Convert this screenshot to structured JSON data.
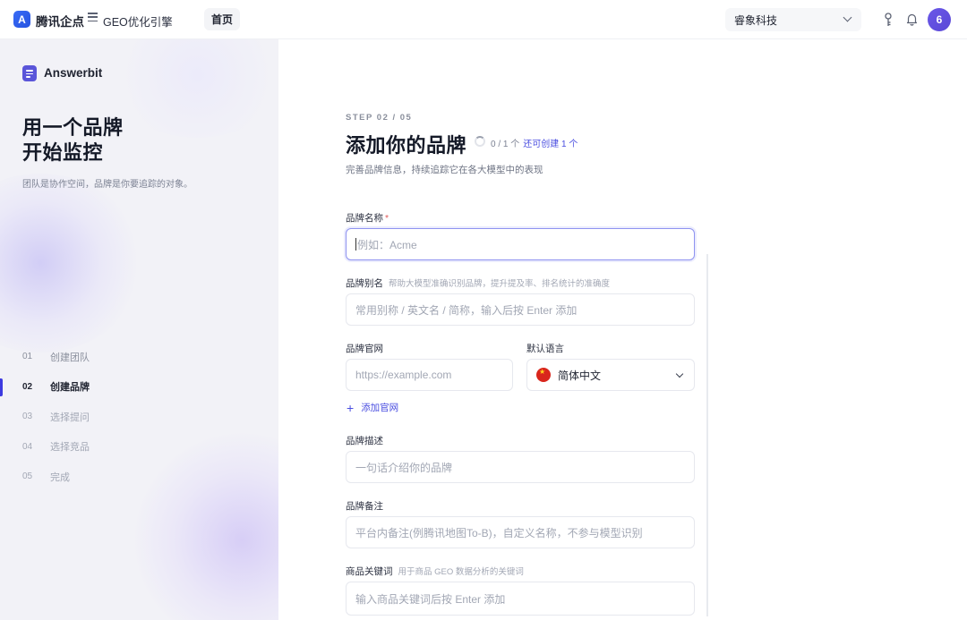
{
  "topbar": {
    "logo_letter": "A",
    "app_title": "腾讯企点",
    "product_name": "GEO优化引擎",
    "home_tab": "首页",
    "org_name": "睿象科技",
    "avatar_text": "6"
  },
  "sidebar": {
    "brand_name": "Answerbit",
    "hero_line1": "用一个品牌",
    "hero_line2": "开始监控",
    "hero_sub": "团队是协作空间，品牌是你要追踪的对象。",
    "steps": [
      {
        "num": "01",
        "label": "创建团队"
      },
      {
        "num": "02",
        "label": "创建品牌"
      },
      {
        "num": "03",
        "label": "选择提问"
      },
      {
        "num": "04",
        "label": "选择竞品"
      },
      {
        "num": "05",
        "label": "完成"
      }
    ]
  },
  "main": {
    "step_no": "STEP 02 / 05",
    "title": "添加你的品牌",
    "count": "0 / 1 个",
    "count_link": "还可创建 1 个",
    "subtitle": "完善品牌信息，持续追踪它在各大模型中的表现",
    "brand_name_label": "品牌名称",
    "brand_name_req": "*",
    "brand_name_placeholder": "例如：Acme",
    "alias_label": "品牌别名",
    "alias_hint": "帮助大模型准确识别品牌，提升提及率、排名统计的准确度",
    "alias_placeholder": "常用别称 / 英文名 / 简称，输入后按 Enter 添加",
    "site_label": "品牌官网",
    "site_placeholder": "https://example.com",
    "lang_label": "默认语言",
    "lang_value": "简体中文",
    "add_site": "添加官网",
    "desc_label": "品牌描述",
    "desc_placeholder": "一句话介绍你的品牌",
    "note_label": "品牌备注",
    "note_placeholder": "平台内备注(例腾讯地图To-B)，自定义名称，不参与模型识别",
    "keyword_label": "商品关键词",
    "keyword_hint": "用于商品 GEO 数据分析的关键词",
    "keyword_placeholder": "输入商品关键词后按 Enter 添加"
  }
}
